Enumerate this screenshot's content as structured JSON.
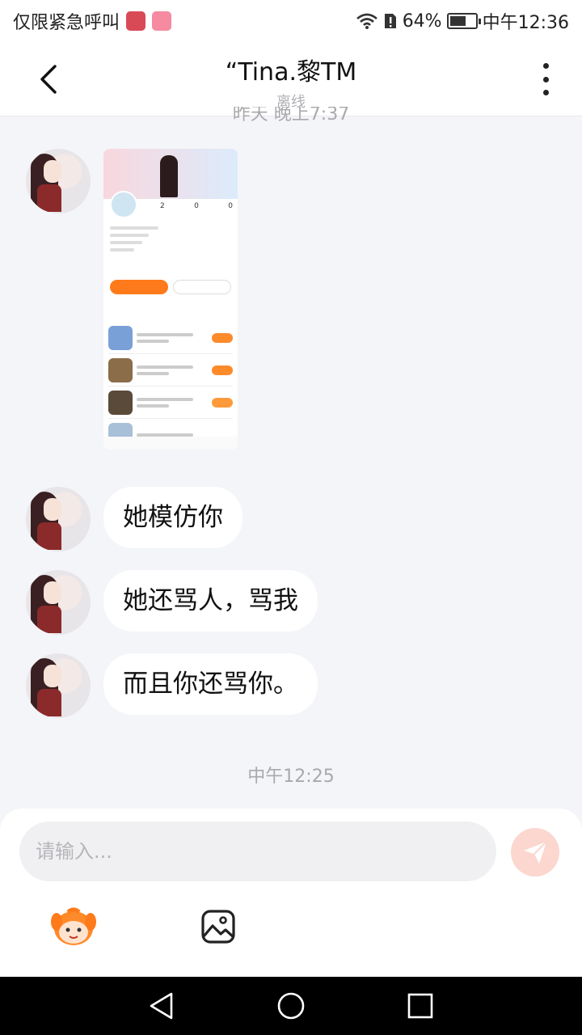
{
  "status_bar": {
    "carrier_text": "仅限紧急呼叫",
    "battery_percent": "64%",
    "battery_level": 0.64,
    "time": "中午12:36"
  },
  "header": {
    "title": "“Tina.黎TM",
    "subtitle": "离线"
  },
  "chat": {
    "timestamp_top": "昨天 晚上7:37",
    "messages": [
      {
        "type": "image",
        "text": ""
      },
      {
        "type": "text",
        "text": "她模仿你"
      },
      {
        "type": "text",
        "text": "她还骂人，骂我"
      },
      {
        "type": "text",
        "text": "而且你还骂你。"
      }
    ],
    "timestamp_mid": "中午12:25"
  },
  "input_bar": {
    "placeholder": "请输入..."
  },
  "colors": {
    "accent": "#ff7a1a",
    "send_disabled": "#fcd7cf",
    "background": "#f4f5f8"
  },
  "icons": [
    "back-arrow-icon",
    "more-icon",
    "send-icon",
    "emoji-mascot-icon",
    "image-icon",
    "nav-back-icon",
    "nav-home-icon",
    "nav-recents-icon"
  ]
}
